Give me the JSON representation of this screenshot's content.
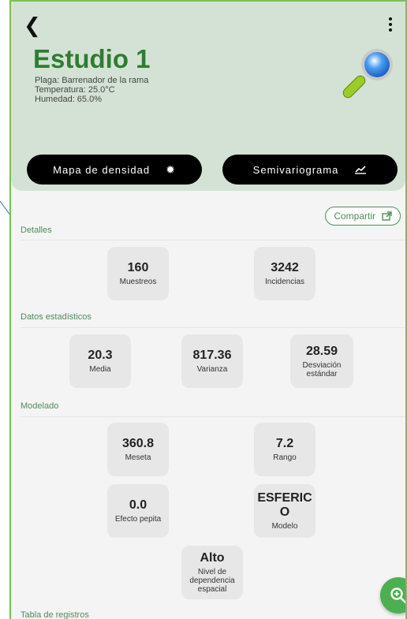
{
  "header": {
    "title": "Estudio 1",
    "pest": "Plaga: Barrenador de la rama",
    "temperature": "Temperatura: 25.0°C",
    "humidity": "Humedad: 65.0%",
    "density_button": "Mapa de densidad",
    "semivariogram_button": "Semivariograma"
  },
  "share_label": "Compartir",
  "sections": {
    "details": "Detalles",
    "stats": "Datos estadísticos",
    "model": "Modelado",
    "table": "Tabla de registros"
  },
  "details": {
    "samples_value": "160",
    "samples_label": "Muestreos",
    "incidences_value": "3242",
    "incidences_label": "Incidencias"
  },
  "stats": {
    "mean_value": "20.3",
    "mean_label": "Media",
    "variance_value": "817.36",
    "variance_label": "Varianza",
    "std_value": "28.59",
    "std_label": "Desviación estándar"
  },
  "model": {
    "sill_value": "360.8",
    "sill_label": "Meseta",
    "range_value": "7.2",
    "range_label": "Rango",
    "nugget_value": "0.0",
    "nugget_label": "Efecto pepita",
    "model_value": "ESFERICO",
    "model_label": "Modelo",
    "dependence_value": "Alto",
    "dependence_label": "Nivel de dependencia espacial"
  },
  "colors": {
    "accent": "#2e7d32",
    "header_bg": "#d4e2d5",
    "fab": "#4caf50"
  }
}
